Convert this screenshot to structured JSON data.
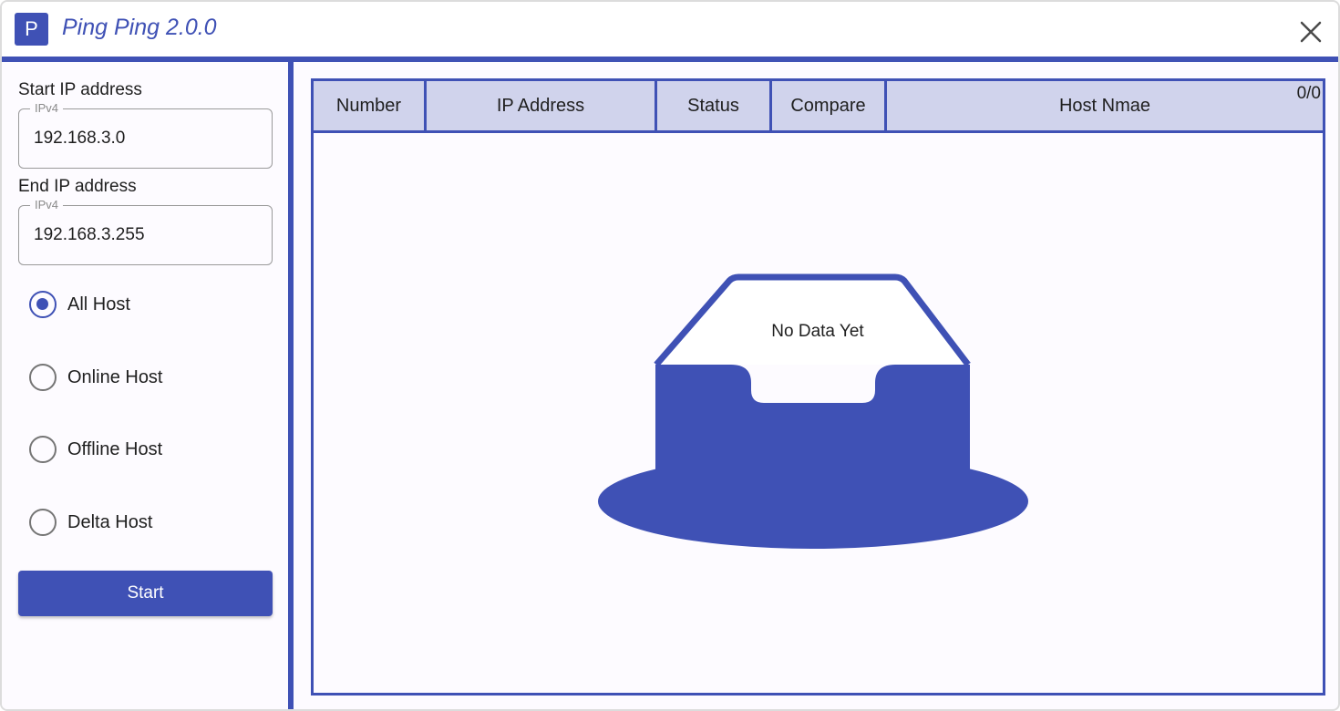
{
  "app": {
    "logo_letter": "P",
    "title": "Ping Ping 2.0.0",
    "accent_color": "#3f51b5"
  },
  "sidebar": {
    "start_ip": {
      "label": "Start IP address",
      "legend": "IPv4",
      "value": "192.168.3.0"
    },
    "end_ip": {
      "label": "End IP address",
      "legend": "IPv4",
      "value": "192.168.3.255"
    },
    "filters": [
      {
        "label": "All Host",
        "checked": true
      },
      {
        "label": "Online Host",
        "checked": false
      },
      {
        "label": "Offline Host",
        "checked": false
      },
      {
        "label": "Delta Host",
        "checked": false
      }
    ],
    "start_button": "Start"
  },
  "grid": {
    "columns": [
      "Number",
      "IP Address",
      "Status",
      "Compare",
      "Host Nmae"
    ],
    "count": "0/0",
    "empty_message": "No Data Yet",
    "rows": []
  }
}
